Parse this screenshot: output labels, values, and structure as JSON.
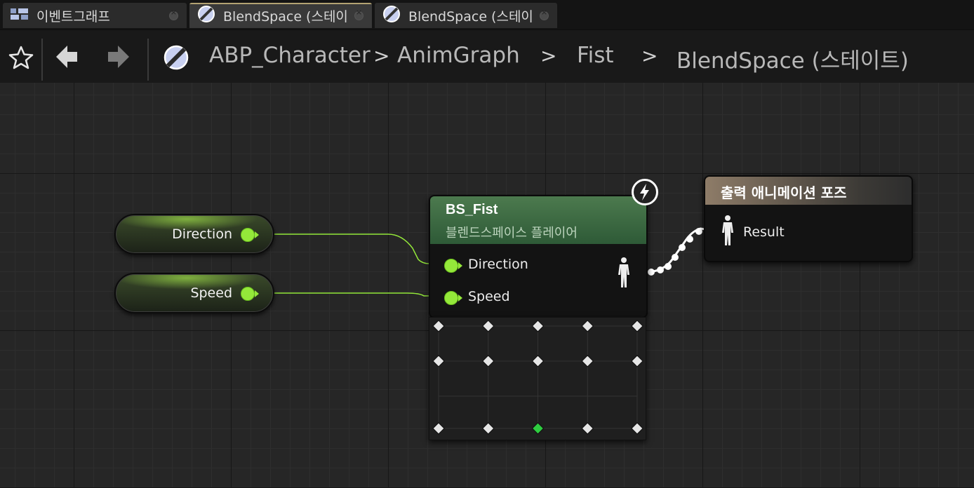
{
  "tabs": [
    {
      "label": "이벤트그래프",
      "icon": "event-graph-icon",
      "active": false
    },
    {
      "label": "BlendSpace (스테이",
      "icon": "blendspace-icon",
      "active": true
    },
    {
      "label": "BlendSpace (스테이",
      "icon": "blendspace-icon",
      "active": false
    }
  ],
  "breadcrumb": {
    "items": [
      "ABP_Character",
      "AnimGraph",
      "Fist",
      "BlendSpace (스테이트)"
    ],
    "separator": ">"
  },
  "graph": {
    "variables": [
      {
        "label": "Direction",
        "type": "float"
      },
      {
        "label": "Speed",
        "type": "float"
      }
    ],
    "blendspace_node": {
      "title": "BS_Fist",
      "subtitle": "블렌드스페이스 플레이어",
      "inputs": [
        "Direction",
        "Speed"
      ],
      "output": "pose",
      "grid_columns": 5,
      "grid_rows": 3,
      "active_sample_col": 2,
      "active_sample_row": 2
    },
    "output_node": {
      "title": "출력 애니메이션 포즈",
      "input_label": "Result"
    }
  },
  "colors": {
    "float_pin": "#94e83a",
    "bs_header": "#4c7a4e",
    "output_header": "#8e7c68",
    "active_tab_accent": "#b3a372",
    "active_sample": "#2ecc40"
  }
}
